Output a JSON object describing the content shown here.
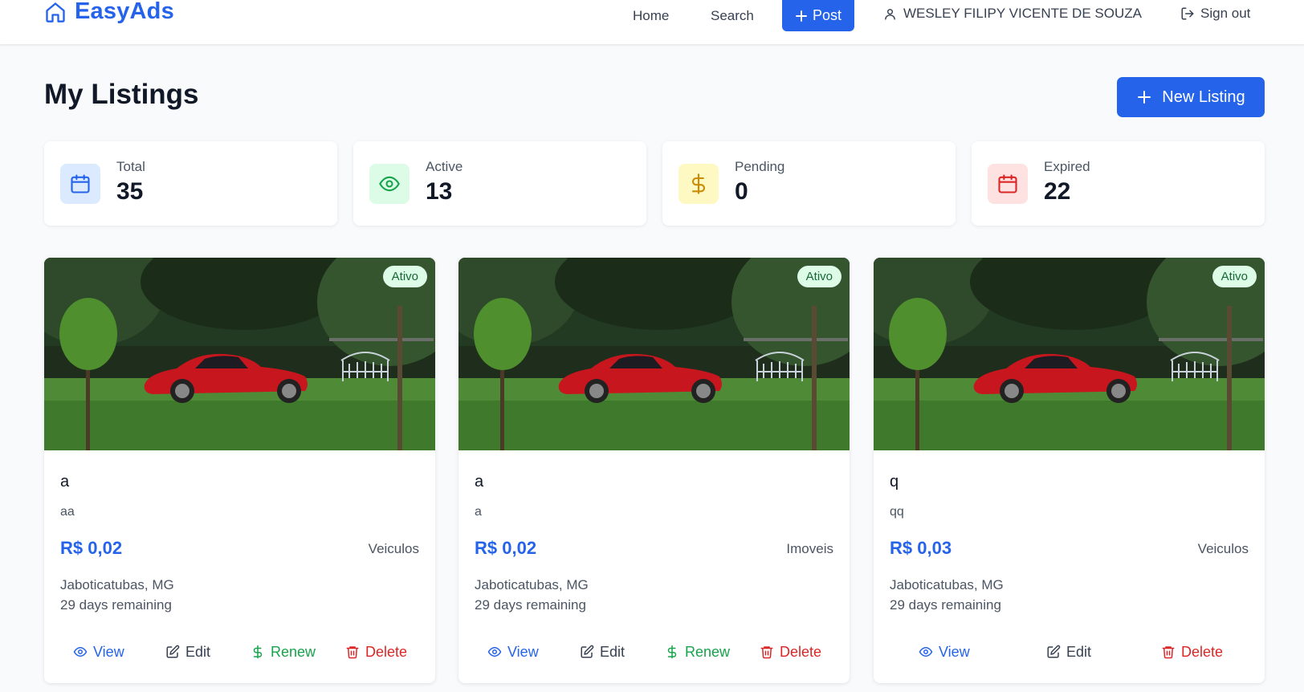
{
  "header": {
    "brand": "EasyAds",
    "nav_home": "Home",
    "nav_search": "Search",
    "post_label": "Post",
    "user_name": "WESLEY FILIPY VICENTE DE SOUZA",
    "signout_label": "Sign out"
  },
  "page": {
    "title": "My Listings",
    "new_listing_label": "New Listing"
  },
  "stats": [
    {
      "label": "Total",
      "value": "35",
      "icon": "calendar-icon",
      "color": "#2563eb",
      "bg": "#dbeafe"
    },
    {
      "label": "Active",
      "value": "13",
      "icon": "eye-icon",
      "color": "#16a34a",
      "bg": "#dcfce7"
    },
    {
      "label": "Pending",
      "value": "0",
      "icon": "dollar-icon",
      "color": "#ca8a04",
      "bg": "#fef9c3"
    },
    {
      "label": "Expired",
      "value": "22",
      "icon": "calendar-icon",
      "color": "#dc2626",
      "bg": "#fee2e2"
    }
  ],
  "listings": [
    {
      "status": "Ativo",
      "title": "a",
      "description": "aa",
      "price": "R$ 0,02",
      "category": "Veiculos",
      "location": "Jaboticatubas, MG",
      "remaining": "29 days remaining",
      "actions": {
        "view": "View",
        "edit": "Edit",
        "renew": "Renew",
        "delete": "Delete"
      }
    },
    {
      "status": "Ativo",
      "title": "a",
      "description": "a",
      "price": "R$ 0,02",
      "category": "Imoveis",
      "location": "Jaboticatubas, MG",
      "remaining": "29 days remaining",
      "actions": {
        "view": "View",
        "edit": "Edit",
        "renew": "Renew",
        "delete": "Delete"
      }
    },
    {
      "status": "Ativo",
      "title": "q",
      "description": "qq",
      "price": "R$ 0,03",
      "category": "Veiculos",
      "location": "Jaboticatubas, MG",
      "remaining": "29 days remaining",
      "actions": {
        "view": "View",
        "edit": "Edit",
        "delete": "Delete"
      }
    }
  ],
  "colors": {
    "accent": "#2563eb",
    "active_badge_bg": "#dcfce7",
    "active_badge_text": "#166534",
    "renew": "#16a34a",
    "delete": "#dc2626"
  }
}
